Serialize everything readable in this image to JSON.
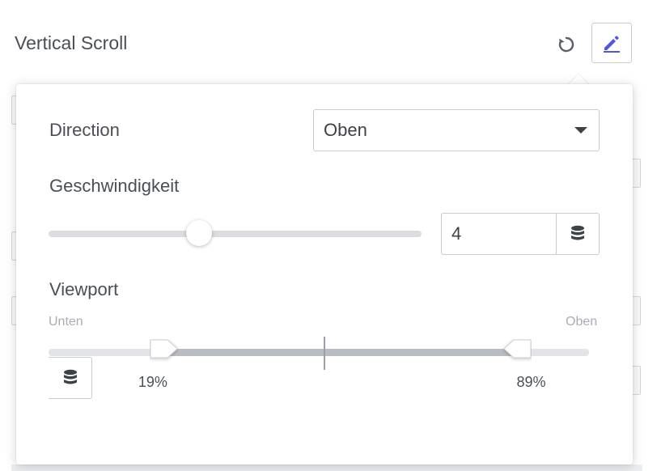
{
  "control": {
    "title": "Vertical Scroll",
    "reset_icon": "reset-icon",
    "edit_icon": "pencil-icon",
    "accent_color": "#4f55e4"
  },
  "popover": {
    "direction": {
      "label": "Direction",
      "selected": "Oben"
    },
    "speed": {
      "label": "Geschwindigkeit",
      "value": "4",
      "slider_fraction": 0.4,
      "dynamic_icon": "database-icon"
    },
    "viewport": {
      "label": "Viewport",
      "start_label": "Unten",
      "end_label": "Oben",
      "lower": 19,
      "upper": 89,
      "lower_text": "19%",
      "upper_text": "89%",
      "dynamic_icon": "database-icon"
    }
  }
}
